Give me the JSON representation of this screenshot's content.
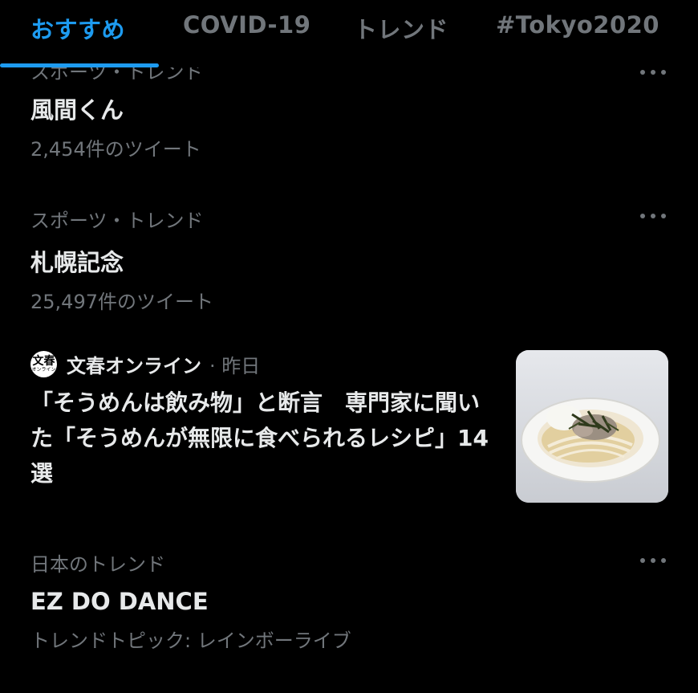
{
  "tabs": [
    {
      "label": "おすすめ"
    },
    {
      "label": "COVID-19"
    },
    {
      "label": "トレンド"
    },
    {
      "label": "#Tokyo2020"
    }
  ],
  "trends": [
    {
      "category": "スポーツ・トレンド",
      "title": "風間くん",
      "count": "2,454件のツイート"
    },
    {
      "category": "スポーツ・トレンド",
      "title": "札幌記念",
      "count": "25,497件のツイート"
    },
    {
      "category": "日本のトレンド",
      "title": "EZ DO DANCE",
      "count": "トレンドトピック: レインボーライブ"
    }
  ],
  "news": {
    "logo_text": "文春",
    "logo_subtext": "オンライン",
    "source": "文春オンライン",
    "time": "· 昨日",
    "headline": "「そうめんは飲み物」と断言　専門家に聞いた「そうめんが無限に食べられるレシピ」14選",
    "thumbnail_icon": "somen-dish-photo"
  },
  "colors": {
    "background": "#000000",
    "accent": "#1d9bf0",
    "primary_text": "#e7e9ea",
    "secondary_text": "#71767b"
  }
}
